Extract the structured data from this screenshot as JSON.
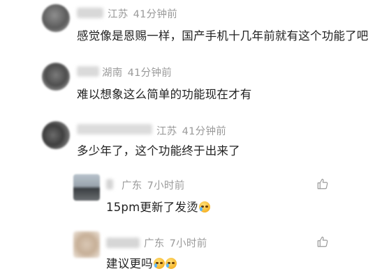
{
  "comments": [
    {
      "region": "江苏",
      "time": "41分钟前",
      "text": "感觉像是恩赐一样，国产手机十几年前就有这个功能了吧"
    },
    {
      "region": "湖南",
      "time": "41分钟前",
      "text": "难以想象这么简单的功能现在才有"
    },
    {
      "region": "江苏",
      "time": "41分钟前",
      "text": "多少年了，这个功能终于出来了"
    }
  ],
  "replies": [
    {
      "region": "广东",
      "time": "7小时前",
      "text": "15pm更新了发烫",
      "emoji_icons": [
        "crying-face-icon"
      ]
    },
    {
      "region": "广东",
      "time": "7小时前",
      "text": "建议更吗",
      "emoji_icons": [
        "crying-face-icon",
        "crying-face-icon"
      ]
    }
  ],
  "icons": {
    "like": "thumbs-up-icon"
  },
  "colors": {
    "meta_text": "#9a9a9a",
    "body_text": "#222222",
    "background": "#ffffff"
  }
}
